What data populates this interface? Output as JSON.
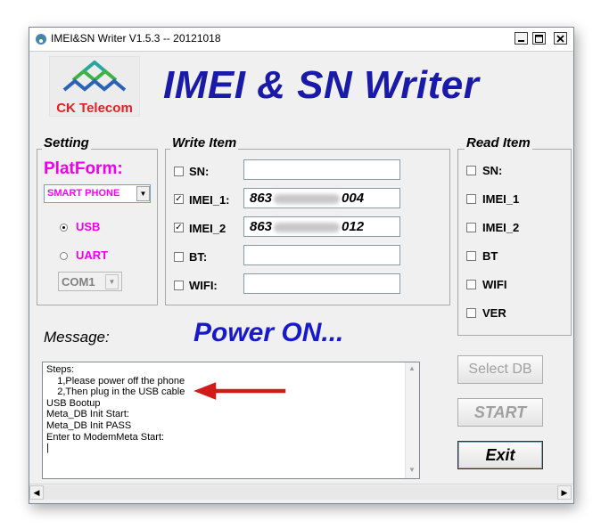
{
  "window": {
    "title": "IMEI&SN Writer V1.5.3 -- 20121018",
    "minimize_glyph": "_",
    "maximize_glyph": "□",
    "close_glyph": "✕"
  },
  "logo": {
    "text": "CK Telecom",
    "colors": {
      "teal": "#2aa6a0",
      "green": "#3eb24a",
      "blue": "#2a62b8",
      "red": "#e22222"
    }
  },
  "heading": "IMEI & SN Writer",
  "setting": {
    "title": "Setting",
    "platform_label": "PlatForm:",
    "platform_value": "SMART PHONE",
    "usb_label": "USB",
    "usb_selected": true,
    "uart_label": "UART",
    "uart_selected": false,
    "com_value": "COM1"
  },
  "write_item": {
    "title": "Write Item",
    "rows": [
      {
        "label": "SN:",
        "checked": false,
        "value_prefix": "",
        "value_suffix": "",
        "obscured": false
      },
      {
        "label": "IMEI_1:",
        "checked": true,
        "value_prefix": "863",
        "value_suffix": "004",
        "obscured": true
      },
      {
        "label": "IMEI_2",
        "checked": true,
        "value_prefix": "863",
        "value_suffix": "012",
        "obscured": true
      },
      {
        "label": "BT:",
        "checked": false,
        "value_prefix": "",
        "value_suffix": "",
        "obscured": false
      },
      {
        "label": "WIFI:",
        "checked": false,
        "value_prefix": "",
        "value_suffix": "",
        "obscured": false
      }
    ]
  },
  "read_item": {
    "title": "Read Item",
    "items": [
      {
        "label": "SN:",
        "checked": false
      },
      {
        "label": "IMEI_1",
        "checked": false
      },
      {
        "label": "IMEI_2",
        "checked": false
      },
      {
        "label": "BT",
        "checked": false
      },
      {
        "label": "WIFI",
        "checked": false
      },
      {
        "label": "VER",
        "checked": false
      }
    ]
  },
  "message_label": "Message:",
  "status": "Power ON...",
  "status_color": "#1818cc",
  "log_lines": [
    "Steps:",
    "    1,Please power off the phone",
    "    2,Then plug in the USB cable",
    "USB Bootup",
    "Meta_DB Init Start:",
    "Meta_DB Init PASS",
    "Enter to ModemMeta Start:",
    "|"
  ],
  "buttons": {
    "select_db": "Select DB",
    "start": "START",
    "exit": "Exit"
  },
  "annotation_arrow_color": "#d11a1a",
  "colors": {
    "heading": "#1a1aa8",
    "platform": "#ee00ee",
    "disabled": "#a0a0a0"
  }
}
